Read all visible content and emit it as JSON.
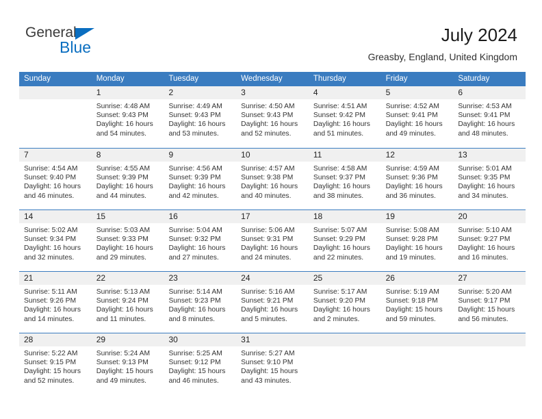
{
  "logo": {
    "primary_text": "General",
    "secondary_text": "Blue",
    "primary_color": "#3a3a3a",
    "accent_color": "#0a6ec0"
  },
  "header": {
    "title": "July 2024",
    "location": "Greasby, England, United Kingdom"
  },
  "theme": {
    "header_row_bg": "#3a7cc0",
    "header_row_text": "#ffffff",
    "daynum_band_bg": "#f0f0f0",
    "cell_bg": "#ffffff",
    "separator": "#3a7cc0"
  },
  "weekdays": [
    "Sunday",
    "Monday",
    "Tuesday",
    "Wednesday",
    "Thursday",
    "Friday",
    "Saturday"
  ],
  "weeks": [
    [
      {
        "day": "",
        "lines": []
      },
      {
        "day": "1",
        "lines": [
          "Sunrise: 4:48 AM",
          "Sunset: 9:43 PM",
          "Daylight: 16 hours",
          "and 54 minutes."
        ]
      },
      {
        "day": "2",
        "lines": [
          "Sunrise: 4:49 AM",
          "Sunset: 9:43 PM",
          "Daylight: 16 hours",
          "and 53 minutes."
        ]
      },
      {
        "day": "3",
        "lines": [
          "Sunrise: 4:50 AM",
          "Sunset: 9:43 PM",
          "Daylight: 16 hours",
          "and 52 minutes."
        ]
      },
      {
        "day": "4",
        "lines": [
          "Sunrise: 4:51 AM",
          "Sunset: 9:42 PM",
          "Daylight: 16 hours",
          "and 51 minutes."
        ]
      },
      {
        "day": "5",
        "lines": [
          "Sunrise: 4:52 AM",
          "Sunset: 9:41 PM",
          "Daylight: 16 hours",
          "and 49 minutes."
        ]
      },
      {
        "day": "6",
        "lines": [
          "Sunrise: 4:53 AM",
          "Sunset: 9:41 PM",
          "Daylight: 16 hours",
          "and 48 minutes."
        ]
      }
    ],
    [
      {
        "day": "7",
        "lines": [
          "Sunrise: 4:54 AM",
          "Sunset: 9:40 PM",
          "Daylight: 16 hours",
          "and 46 minutes."
        ]
      },
      {
        "day": "8",
        "lines": [
          "Sunrise: 4:55 AM",
          "Sunset: 9:39 PM",
          "Daylight: 16 hours",
          "and 44 minutes."
        ]
      },
      {
        "day": "9",
        "lines": [
          "Sunrise: 4:56 AM",
          "Sunset: 9:39 PM",
          "Daylight: 16 hours",
          "and 42 minutes."
        ]
      },
      {
        "day": "10",
        "lines": [
          "Sunrise: 4:57 AM",
          "Sunset: 9:38 PM",
          "Daylight: 16 hours",
          "and 40 minutes."
        ]
      },
      {
        "day": "11",
        "lines": [
          "Sunrise: 4:58 AM",
          "Sunset: 9:37 PM",
          "Daylight: 16 hours",
          "and 38 minutes."
        ]
      },
      {
        "day": "12",
        "lines": [
          "Sunrise: 4:59 AM",
          "Sunset: 9:36 PM",
          "Daylight: 16 hours",
          "and 36 minutes."
        ]
      },
      {
        "day": "13",
        "lines": [
          "Sunrise: 5:01 AM",
          "Sunset: 9:35 PM",
          "Daylight: 16 hours",
          "and 34 minutes."
        ]
      }
    ],
    [
      {
        "day": "14",
        "lines": [
          "Sunrise: 5:02 AM",
          "Sunset: 9:34 PM",
          "Daylight: 16 hours",
          "and 32 minutes."
        ]
      },
      {
        "day": "15",
        "lines": [
          "Sunrise: 5:03 AM",
          "Sunset: 9:33 PM",
          "Daylight: 16 hours",
          "and 29 minutes."
        ]
      },
      {
        "day": "16",
        "lines": [
          "Sunrise: 5:04 AM",
          "Sunset: 9:32 PM",
          "Daylight: 16 hours",
          "and 27 minutes."
        ]
      },
      {
        "day": "17",
        "lines": [
          "Sunrise: 5:06 AM",
          "Sunset: 9:31 PM",
          "Daylight: 16 hours",
          "and 24 minutes."
        ]
      },
      {
        "day": "18",
        "lines": [
          "Sunrise: 5:07 AM",
          "Sunset: 9:29 PM",
          "Daylight: 16 hours",
          "and 22 minutes."
        ]
      },
      {
        "day": "19",
        "lines": [
          "Sunrise: 5:08 AM",
          "Sunset: 9:28 PM",
          "Daylight: 16 hours",
          "and 19 minutes."
        ]
      },
      {
        "day": "20",
        "lines": [
          "Sunrise: 5:10 AM",
          "Sunset: 9:27 PM",
          "Daylight: 16 hours",
          "and 16 minutes."
        ]
      }
    ],
    [
      {
        "day": "21",
        "lines": [
          "Sunrise: 5:11 AM",
          "Sunset: 9:26 PM",
          "Daylight: 16 hours",
          "and 14 minutes."
        ]
      },
      {
        "day": "22",
        "lines": [
          "Sunrise: 5:13 AM",
          "Sunset: 9:24 PM",
          "Daylight: 16 hours",
          "and 11 minutes."
        ]
      },
      {
        "day": "23",
        "lines": [
          "Sunrise: 5:14 AM",
          "Sunset: 9:23 PM",
          "Daylight: 16 hours",
          "and 8 minutes."
        ]
      },
      {
        "day": "24",
        "lines": [
          "Sunrise: 5:16 AM",
          "Sunset: 9:21 PM",
          "Daylight: 16 hours",
          "and 5 minutes."
        ]
      },
      {
        "day": "25",
        "lines": [
          "Sunrise: 5:17 AM",
          "Sunset: 9:20 PM",
          "Daylight: 16 hours",
          "and 2 minutes."
        ]
      },
      {
        "day": "26",
        "lines": [
          "Sunrise: 5:19 AM",
          "Sunset: 9:18 PM",
          "Daylight: 15 hours",
          "and 59 minutes."
        ]
      },
      {
        "day": "27",
        "lines": [
          "Sunrise: 5:20 AM",
          "Sunset: 9:17 PM",
          "Daylight: 15 hours",
          "and 56 minutes."
        ]
      }
    ],
    [
      {
        "day": "28",
        "lines": [
          "Sunrise: 5:22 AM",
          "Sunset: 9:15 PM",
          "Daylight: 15 hours",
          "and 52 minutes."
        ]
      },
      {
        "day": "29",
        "lines": [
          "Sunrise: 5:24 AM",
          "Sunset: 9:13 PM",
          "Daylight: 15 hours",
          "and 49 minutes."
        ]
      },
      {
        "day": "30",
        "lines": [
          "Sunrise: 5:25 AM",
          "Sunset: 9:12 PM",
          "Daylight: 15 hours",
          "and 46 minutes."
        ]
      },
      {
        "day": "31",
        "lines": [
          "Sunrise: 5:27 AM",
          "Sunset: 9:10 PM",
          "Daylight: 15 hours",
          "and 43 minutes."
        ]
      },
      {
        "day": "",
        "lines": []
      },
      {
        "day": "",
        "lines": []
      },
      {
        "day": "",
        "lines": []
      }
    ]
  ]
}
